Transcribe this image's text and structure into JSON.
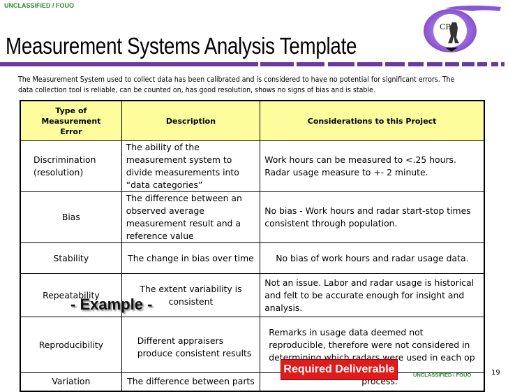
{
  "header": {
    "classification": "UNCLASSIFIED / FOUO",
    "title": "Measurement Systems Analysis Template",
    "logo_letters": "CPI",
    "accent_color": "#6a3a9e"
  },
  "intro": "The Measurement System used to collect data has been calibrated and is considered to have no potential for significant errors.  The data collection tool is reliable, can be counted on, has good resolution, shows no signs of bias and is stable.",
  "table": {
    "headers": [
      "Type of Measurement Error",
      "Description",
      "Considerations to this Project"
    ],
    "header_bg": "#fdfd9e",
    "rows": [
      {
        "type": "Discrimination (resolution)",
        "description": "The ability of the measurement system to divide measurements into “data categories”",
        "considerations": "Work hours can be measured to <.25 hours.  Radar usage measure to +- 2 minute."
      },
      {
        "type": "Bias",
        "description": "The difference between an observed average measurement result and a reference value",
        "considerations": "No bias - Work hours and radar start-stop times consistent through population."
      },
      {
        "type": "Stability",
        "description": "The change in bias over time",
        "considerations": "No bias of work hours and radar usage data."
      },
      {
        "type": "Repeatability",
        "description": "The extent variability is consistent",
        "considerations": "Not an issue.  Labor and radar usage is historical and felt to be accurate enough for insight and analysis."
      },
      {
        "type": "Reproducibility",
        "description": "Different appraisers produce consistent results",
        "considerations": "Remarks in usage data deemed not reproducible, therefore were not considered in determining which radars were used in each op"
      },
      {
        "type": "Variation",
        "description": "The difference between parts",
        "considerations": "process."
      }
    ]
  },
  "overlays": {
    "example_label": "- Example -",
    "deliverable_label": "Required Deliverable",
    "deliverable_color": "#e01b1b"
  },
  "footer": {
    "classification": "UNCLASSIFIED / FOUO",
    "page_number": "19"
  }
}
